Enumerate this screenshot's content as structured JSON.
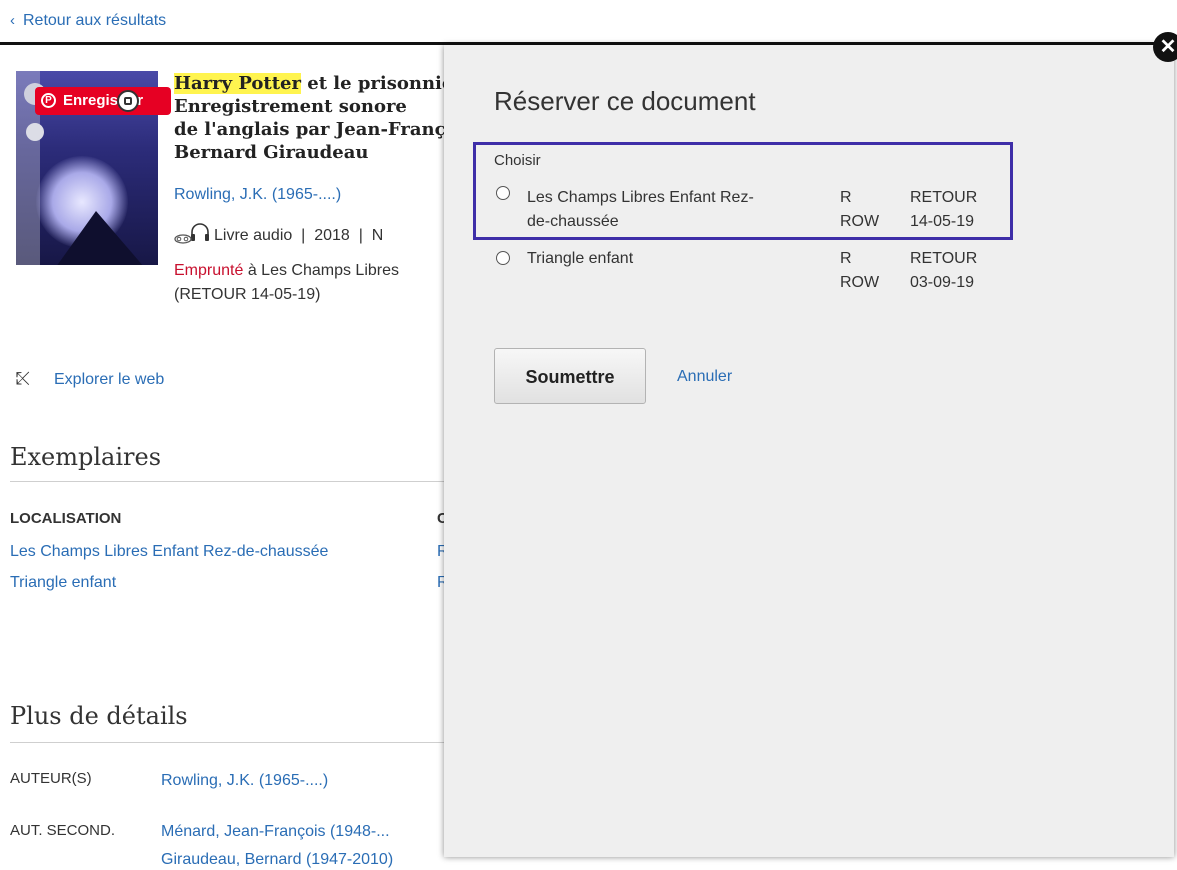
{
  "nav": {
    "back_label": "Retour aux résultats"
  },
  "record": {
    "title_highlight": "Harry Potter",
    "title_line1_rest": " et le prisonnier d'Azkaban",
    "title_line2": "Enregistrement sonore",
    "title_line3": "de l'anglais par Jean-François Ménard",
    "title_line4": "Bernard Giraudeau",
    "author": "Rowling, J.K. (1965-....)",
    "format": "Livre audio",
    "separator": "|",
    "year": "2018",
    "meta_extra": "N",
    "status_word": "Emprunté",
    "status_rest": " à Les Champs Libres",
    "status_line2": "(RETOUR 14-05-19)"
  },
  "pinterest": {
    "label": "Enregistrer"
  },
  "explore": {
    "label": "Explorer le web"
  },
  "copies": {
    "heading": "Exemplaires",
    "col_location": "LOCALISATION",
    "col_second_initial": "C",
    "rows": [
      {
        "location": "Les Champs Libres Enfant Rez-de-chaussée",
        "second_initial": "R"
      },
      {
        "location": "Triangle enfant",
        "second_initial": "R"
      }
    ]
  },
  "details": {
    "heading": "Plus de détails",
    "authors_label": "AUTEUR(S)",
    "authors_value": "Rowling, J.K. (1965-....)",
    "second_label": "AUT. SECOND.",
    "second_value_1": "Ménard, Jean-François (1948-...",
    "second_value_2": "Giraudeau, Bernard (1947-2010)"
  },
  "modal": {
    "title": "Réserver ce document",
    "choose_label": "Choisir",
    "close_label": "✕",
    "options": [
      {
        "location_line1": "Les Champs Libres Enfant Rez-",
        "location_line2": "de-chaussée",
        "cote_line1": "R",
        "cote_line2": "ROW",
        "status_line1": "RETOUR",
        "status_line2": "14-05-19"
      },
      {
        "location_line1": "Triangle enfant",
        "location_line2": "",
        "cote_line1": "R",
        "cote_line2": "ROW",
        "status_line1": "RETOUR",
        "status_line2": "03-09-19"
      }
    ],
    "submit_label": "Soumettre",
    "cancel_label": "Annuler"
  },
  "colors": {
    "link": "#2a6db5",
    "highlight": "#fff44f",
    "pinterest": "#e60023",
    "selection_box": "#3e2ea8",
    "status_red": "#c8102e"
  },
  "icons": {
    "back": "chevron-left-icon",
    "pinterest": "pinterest-icon",
    "visual_search": "visual-search-icon",
    "audio": "headphones-icon",
    "explore": "explore-web-icon",
    "close": "close-icon"
  }
}
